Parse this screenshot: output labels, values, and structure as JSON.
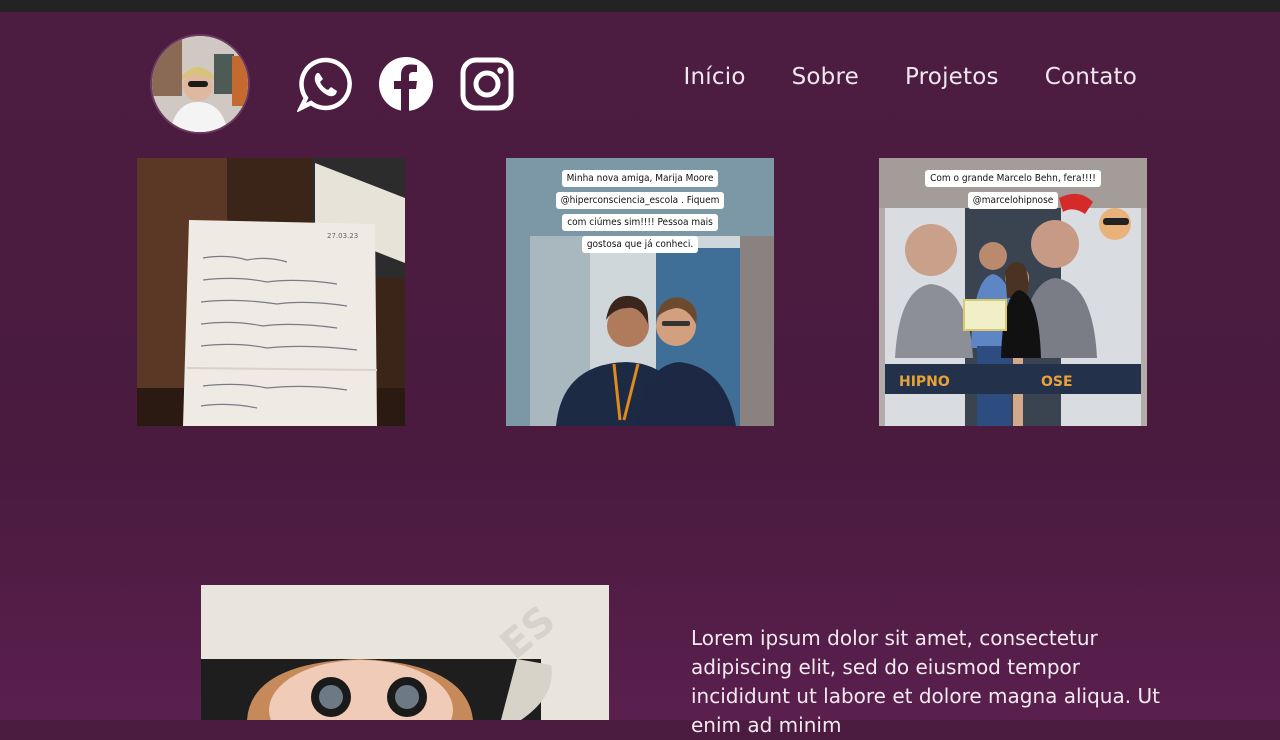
{
  "header": {
    "avatar_alt": "Foto de perfil",
    "social": [
      {
        "name": "whatsapp-icon"
      },
      {
        "name": "facebook-icon"
      },
      {
        "name": "instagram-icon"
      }
    ],
    "nav": [
      {
        "label": "Início"
      },
      {
        "label": "Sobre"
      },
      {
        "label": "Projetos"
      },
      {
        "label": "Contato"
      }
    ]
  },
  "gallery": {
    "photo1": {
      "note_date": "27.03.23"
    },
    "photo2": {
      "caption_lines": [
        "Minha nova amiga, Marija Moore",
        "@hiperconsciencia_escola . Fiquem",
        "com ciúmes sim!!!! Pessoa mais",
        "gostosa que já conheci."
      ]
    },
    "photo3": {
      "caption_lines": [
        "Com o grande Marcelo Behn, fera!!!!",
        "@marcelohipnose"
      ],
      "banner_left": "HIPNO",
      "banner_right": "OSE"
    }
  },
  "section": {
    "text": "Lorem ipsum dolor sit amet, consectetur adipiscing elit, sed do eiusmod tempor incididunt ut labore et dolore magna aliqua. Ut enim ad minim"
  },
  "colors": {
    "background": "#4b1c40",
    "topbar": "#232323",
    "nav_text": "#f0e7ee",
    "icon": "#ffffff"
  }
}
